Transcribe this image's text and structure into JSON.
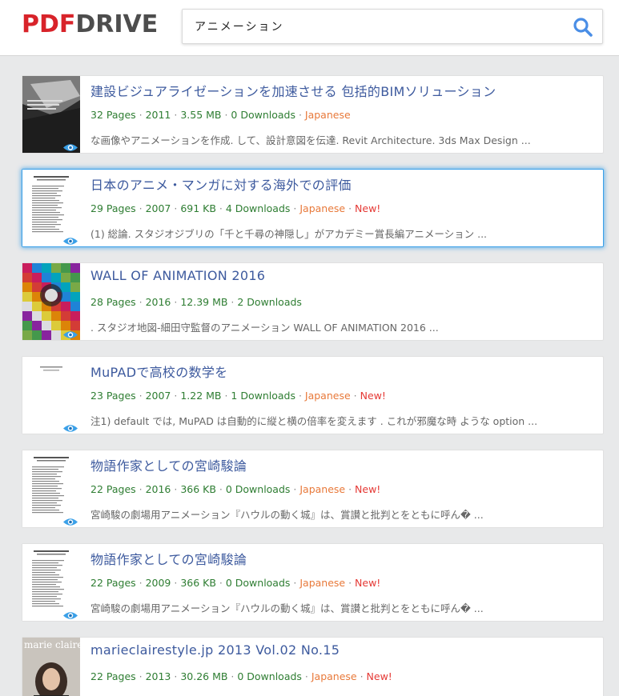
{
  "header": {
    "logo_pdf": "PDF",
    "logo_drive": "DRIVE",
    "search_value": "アニメーション",
    "accent_color": "#4a8ee6"
  },
  "results": [
    {
      "title": "建設ビジュアライゼーションを加速させる 包括的BIMソリューション",
      "pages": "32 Pages",
      "year": "2011",
      "size": "3.55 MB",
      "downloads": "0 Downloads",
      "language": "Japanese",
      "new": "",
      "snippet": "な画像やアニメーションを作成. して、設計意図を伝達. Revit Architecture. 3ds Max Design ...",
      "thumb": "dark-cover"
    },
    {
      "title": "日本のアニメ・マンガに対する海外での評価",
      "pages": "29 Pages",
      "year": "2007",
      "size": "691 KB",
      "downloads": "4 Downloads",
      "language": "Japanese",
      "new": "New!",
      "snippet": "(1) 総論. スタジオジブリの「千と千尋の神隠し」がアカデミー賞長編アニメーション ...",
      "thumb": "text-doc"
    },
    {
      "title": "WALL OF ANIMATION 2016",
      "pages": "28 Pages",
      "year": "2016",
      "size": "12.39 MB",
      "downloads": "2 Downloads",
      "language": "",
      "new": "",
      "snippet": ". スタジオ地図-細田守監督のアニメーション WALL OF ANIMATION 2016 ...",
      "thumb": "colorful-cover"
    },
    {
      "title": "MuPADで高校の数学を",
      "pages": "23 Pages",
      "year": "2007",
      "size": "1.22 MB",
      "downloads": "1 Downloads",
      "language": "Japanese",
      "new": "New!",
      "snippet": "注1) default では, MuPAD は自動的に縦と横の倍率を変えます . これが邪魔な時 ような option ...",
      "thumb": "blank-doc"
    },
    {
      "title": "物語作家としての宮崎駿論",
      "pages": "22 Pages",
      "year": "2016",
      "size": "366 KB",
      "downloads": "0 Downloads",
      "language": "Japanese",
      "new": "New!",
      "snippet": "宮崎駿の劇場用アニメーション『ハウルの動く城』は、賞讃と批判とをともに呼ん� ...",
      "thumb": "text-doc"
    },
    {
      "title": "物語作家としての宮崎駿論",
      "pages": "22 Pages",
      "year": "2009",
      "size": "366 KB",
      "downloads": "0 Downloads",
      "language": "Japanese",
      "new": "New!",
      "snippet": "宮崎駿の劇場用アニメーション『ハウルの動く城』は、賞讃と批判とをともに呼ん� ...",
      "thumb": "text-doc"
    },
    {
      "title": "marieclairestyle.jp 2013 Vol.02 No.15",
      "pages": "22 Pages",
      "year": "2013",
      "size": "30.26 MB",
      "downloads": "0 Downloads",
      "language": "Japanese",
      "new": "New!",
      "snippet": "",
      "thumb": "magazine-cover",
      "thumb_text": "marie claire"
    }
  ]
}
